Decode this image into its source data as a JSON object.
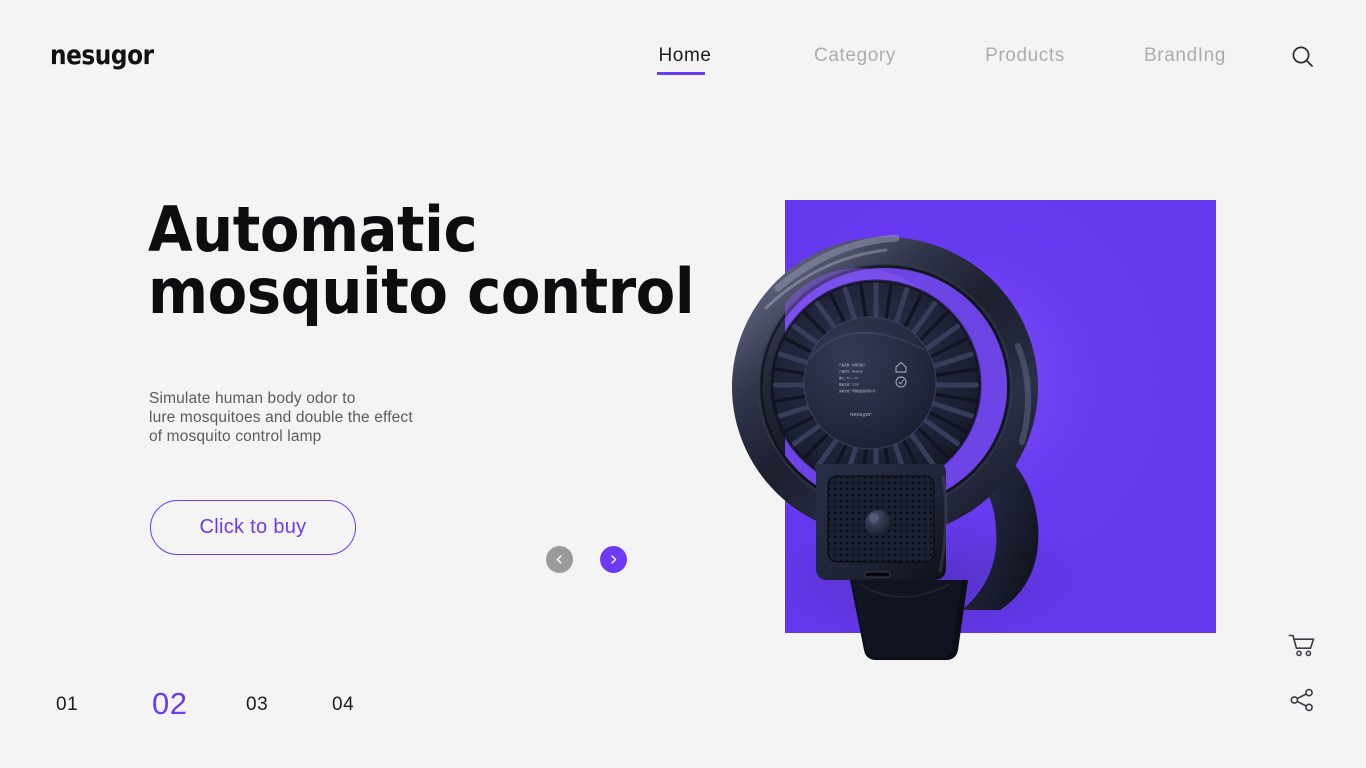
{
  "brand": {
    "logo": "nesugor"
  },
  "nav": {
    "items": [
      {
        "label": "Home",
        "active": true
      },
      {
        "label": "Category",
        "active": false
      },
      {
        "label": "Products",
        "active": false
      },
      {
        "label": "BrandIng",
        "active": false
      }
    ],
    "search_icon": "search-icon"
  },
  "hero": {
    "headline": "Automatic\nmosquito control",
    "subtext": "Simulate human body odor to\nlure mosquitoes and double the effect\nof mosquito control lamp",
    "cta_label": "Click to buy",
    "panel_color": "#6538f0",
    "accent_color": "#6d3bf5",
    "background_color": "#f4f4f4"
  },
  "carousel": {
    "prev_label": "‹",
    "next_label": "›",
    "prev_color": "#9b9b9b",
    "next_color": "#6d3bf5",
    "pages": [
      {
        "label": "01",
        "active": false
      },
      {
        "label": "02",
        "active": true
      },
      {
        "label": "03",
        "active": false
      },
      {
        "label": "04",
        "active": false
      }
    ]
  },
  "rail": {
    "cart_icon": "shopping-cart-icon",
    "share_icon": "share-icon"
  },
  "product": {
    "label_lines": [
      "产品名称：智能灭蚊灯",
      "产品型号：MSX610",
      "输入：5V ⎼ 1A",
      "额定功率：3.5W",
      "深圳市德一风科技发展有限公司"
    ],
    "label_brand": "nesugor"
  }
}
